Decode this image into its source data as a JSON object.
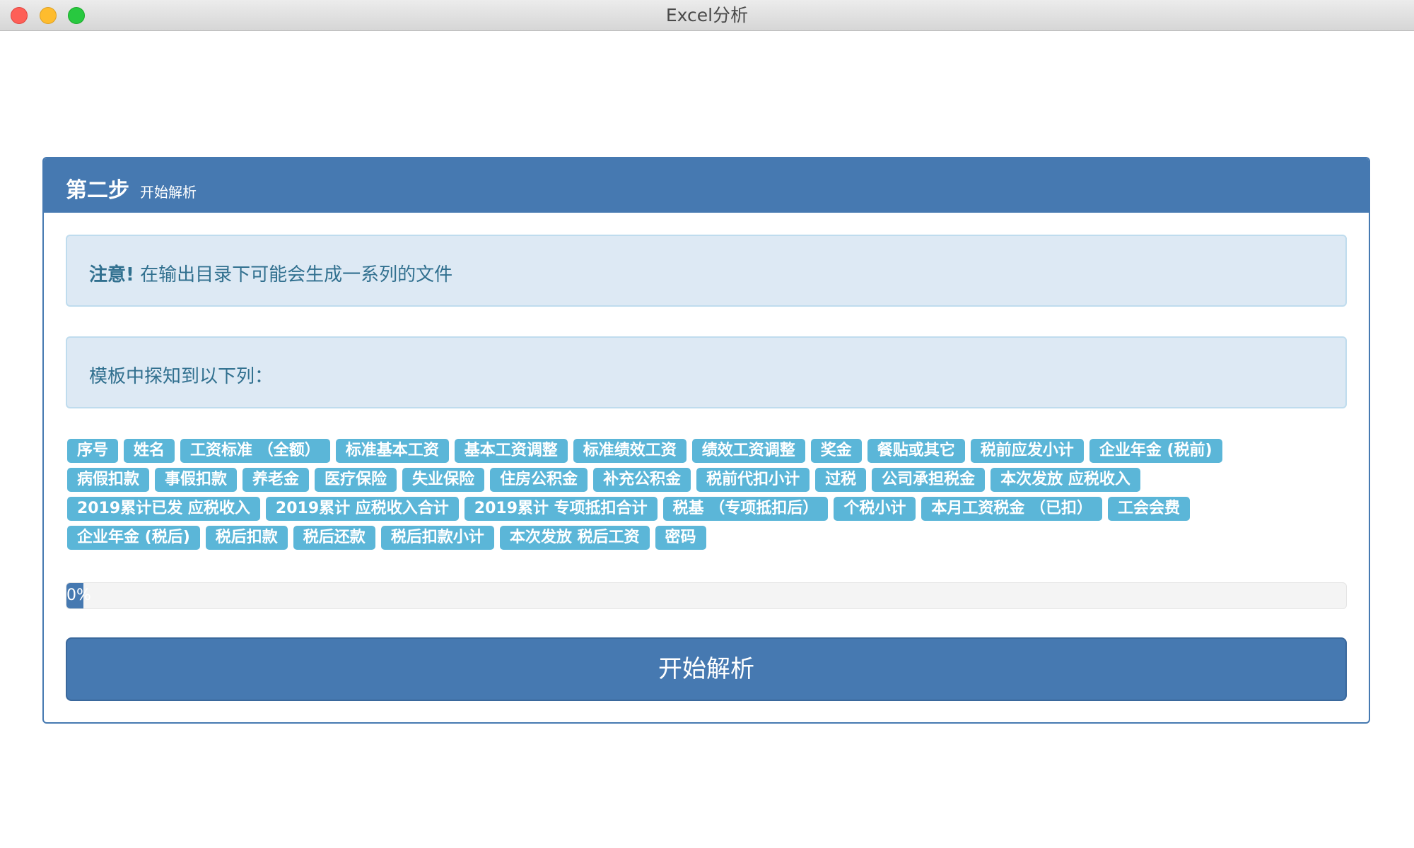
{
  "window": {
    "title": "Excel分析"
  },
  "panel": {
    "title": "第二步",
    "subtitle": "开始解析"
  },
  "alerts": {
    "notice_strong": "注意!",
    "notice_text": " 在输出目录下可能会生成一系列的文件",
    "columns_text": "模板中探知到以下列："
  },
  "columns": [
    [
      "序号",
      "姓名",
      "工资标准 （全额）",
      "标准基本工资",
      "基本工资调整",
      "标准绩效工资",
      "绩效工资调整",
      "奖金",
      "餐贴或其它",
      "税前应发小计",
      "企业年金 (税前)"
    ],
    [
      "病假扣款",
      "事假扣款",
      "养老金",
      "医疗保险",
      "失业保险",
      "住房公积金",
      "补充公积金",
      "税前代扣小计",
      "过税",
      "公司承担税金",
      "本次发放 应税收入"
    ],
    [
      "2019累计已发 应税收入",
      "2019累计 应税收入合计",
      "2019累计 专项抵扣合计",
      "税基 （专项抵扣后）",
      "个税小计",
      "本月工资税金 （已扣）",
      "工会会费"
    ],
    [
      "企业年金 (税后)",
      "税后扣款",
      "税后还款",
      "税后扣款小计",
      "本次发放 税后工资",
      "密码"
    ]
  ],
  "progress": {
    "value": 0,
    "label": "0%"
  },
  "start_button": {
    "label": "开始解析"
  },
  "colors": {
    "primary": "#4679b1",
    "tag": "#5bb6d8",
    "alert_bg": "#dde9f4",
    "alert_text": "#31708f"
  }
}
